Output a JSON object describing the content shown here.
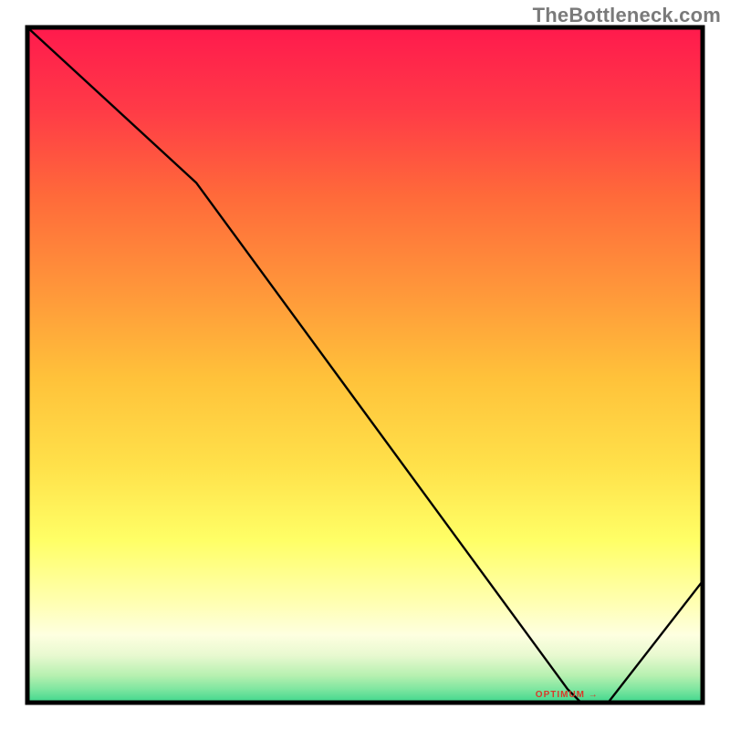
{
  "watermark": "TheBottleneck.com",
  "bottom_tick_text": "OPTIMUM →",
  "chart_data": {
    "type": "line",
    "title": "",
    "xlabel": "",
    "ylabel": "",
    "xlim": [
      0,
      100
    ],
    "ylim": [
      0,
      100
    ],
    "grid": false,
    "legend": false,
    "background_gradient": {
      "direction": "vertical",
      "stops": [
        {
          "pos": 0.0,
          "color": "#ff1a4d"
        },
        {
          "pos": 0.25,
          "color": "#ff6a3a"
        },
        {
          "pos": 0.5,
          "color": "#ffc23a"
        },
        {
          "pos": 0.75,
          "color": "#ffff66"
        },
        {
          "pos": 0.88,
          "color": "#ffffcc"
        },
        {
          "pos": 0.92,
          "color": "#f7fcdc"
        },
        {
          "pos": 0.97,
          "color": "#8fe8a0"
        },
        {
          "pos": 1.0,
          "color": "#3dd68c"
        }
      ]
    },
    "series": [
      {
        "name": "bottleneck-curve",
        "color": "#000000",
        "x": [
          0,
          25,
          80,
          82,
          86,
          100
        ],
        "y": [
          100,
          77,
          2,
          0,
          0,
          18
        ]
      }
    ],
    "annotations": [
      {
        "type": "marker-label",
        "text": "OPTIMUM →",
        "x": 82,
        "y": 0,
        "color": "#d83a2a"
      }
    ]
  }
}
